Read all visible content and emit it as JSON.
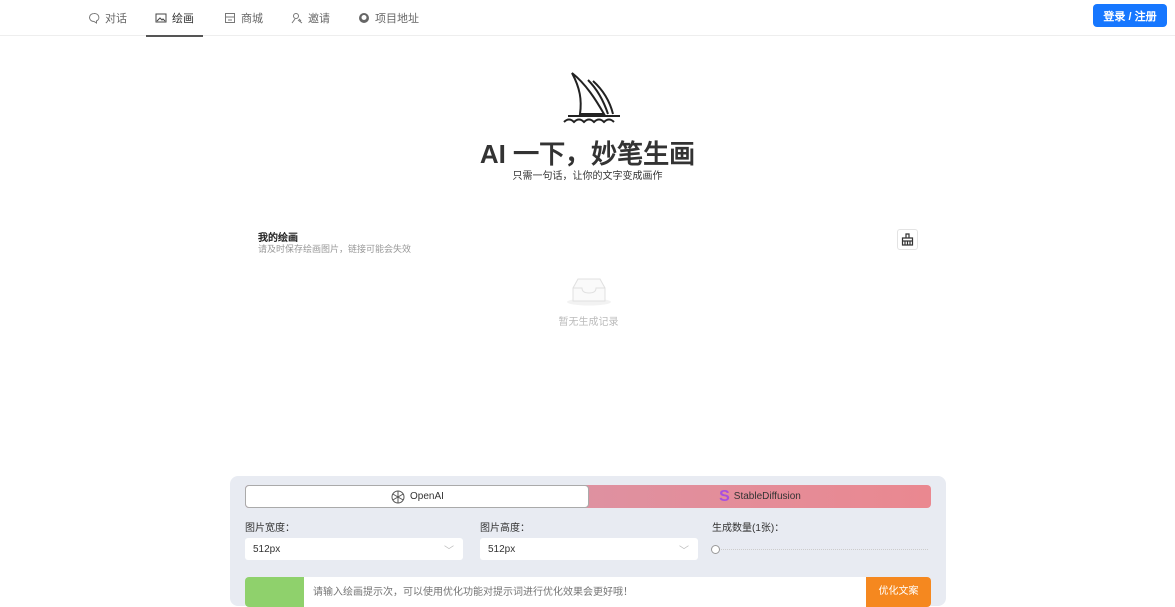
{
  "nav": {
    "items": [
      {
        "label": "对话",
        "icon": "chat-icon"
      },
      {
        "label": "绘画",
        "icon": "image-icon",
        "active": true
      },
      {
        "label": "商城",
        "icon": "shop-icon"
      },
      {
        "label": "邀请",
        "icon": "invite-icon"
      },
      {
        "label": "项目地址",
        "icon": "github-icon"
      }
    ],
    "login_label": "登录 / 注册"
  },
  "hero": {
    "title": "AI 一下，妙笔生画",
    "subtitle": "只需一句话，让你的文字变成画作"
  },
  "gallery": {
    "title": "我的绘画",
    "desc": "请及时保存绘画图片，链接可能会失效",
    "empty": "暂无生成记录"
  },
  "panel": {
    "models": [
      {
        "label": "OpenAI",
        "active": true
      },
      {
        "label": "StableDiffusion"
      }
    ],
    "width_label": "图片宽度：",
    "width_value": "512px",
    "height_label": "图片高度：",
    "height_value": "512px",
    "count_label": "生成数量(1张)：",
    "count_value": 1,
    "prompt_placeholder": "请输入绘画提示次，可以使用优化功能对提示词进行优化效果会更好哦！",
    "optimize_label": "优化文案"
  },
  "colors": {
    "primary": "#1677ff",
    "optimize": "#f5881f",
    "green": "#8fd16c"
  }
}
